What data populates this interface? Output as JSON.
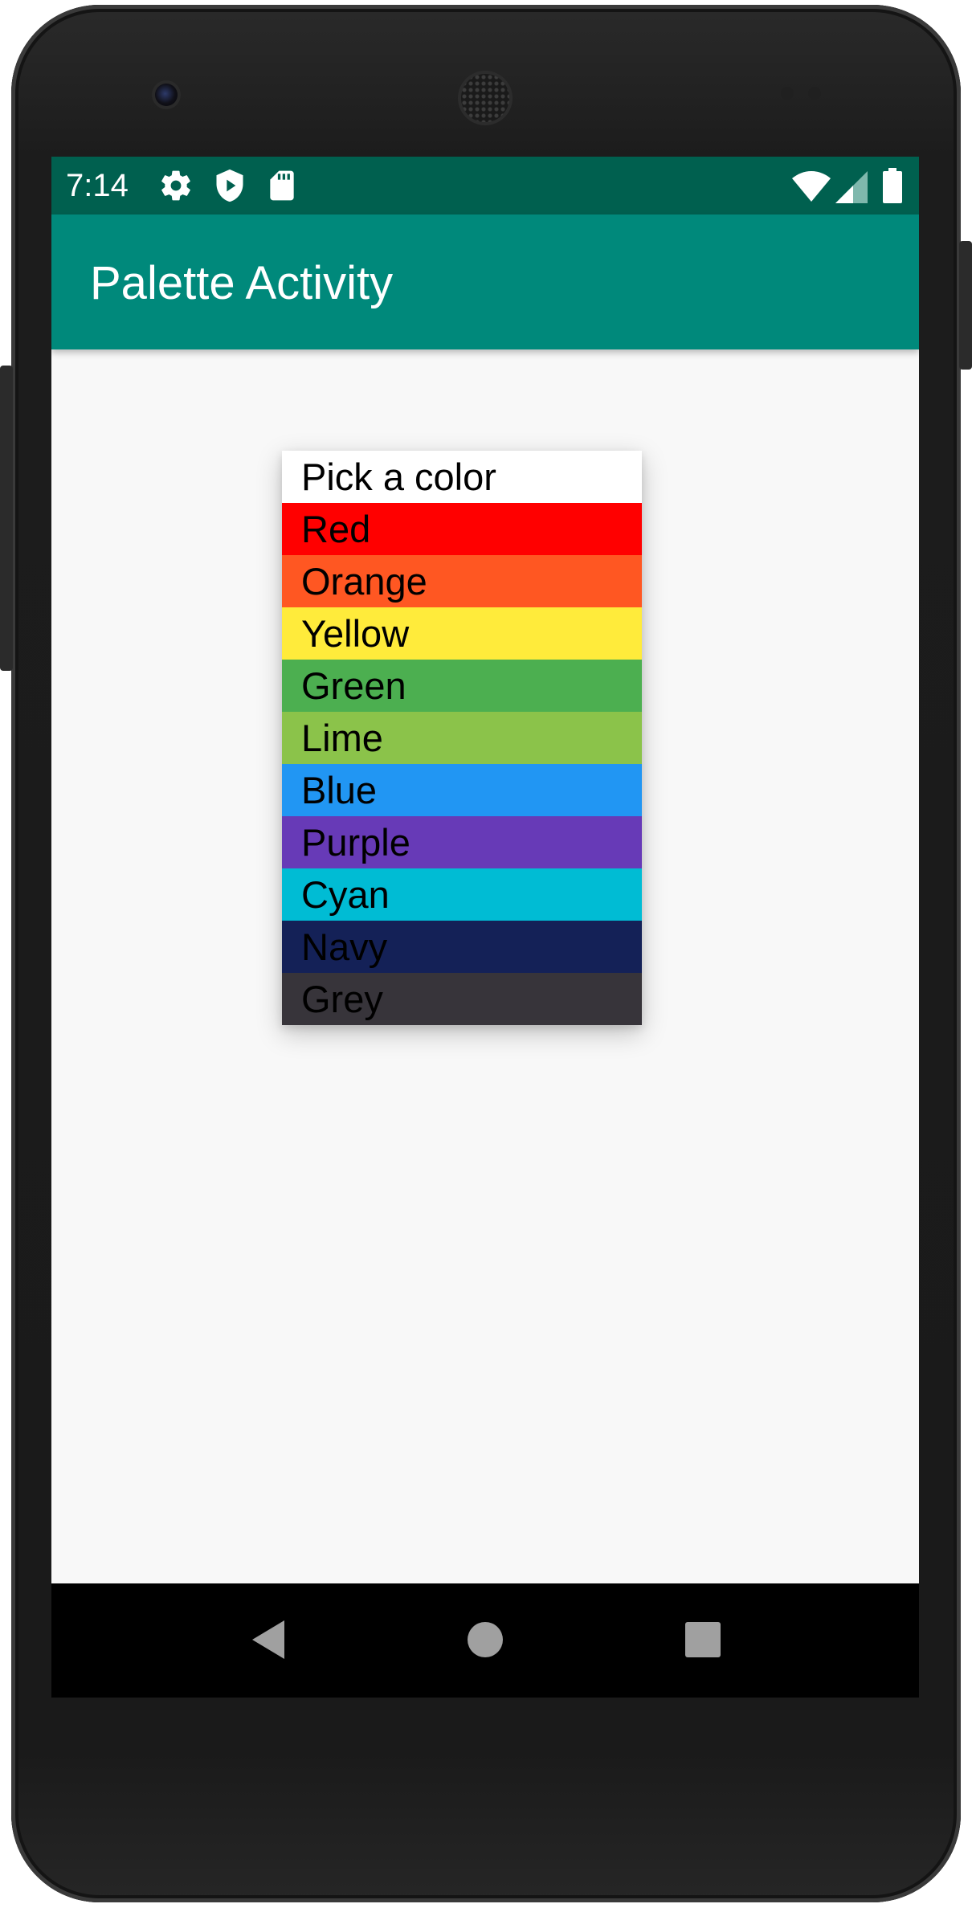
{
  "status_bar": {
    "time": "7:14",
    "left_icons": [
      "settings-gear-icon",
      "play-protect-icon",
      "sd-card-icon"
    ],
    "right_icons": [
      "wifi-icon",
      "cell-signal-icon",
      "battery-icon"
    ]
  },
  "app_bar": {
    "title": "Palette Activity"
  },
  "dropdown": {
    "options": [
      {
        "label": "Pick a color",
        "color": "#ffffff"
      },
      {
        "label": "Red",
        "color": "#ff0000"
      },
      {
        "label": "Orange",
        "color": "#ff5722"
      },
      {
        "label": "Yellow",
        "color": "#ffeb3b"
      },
      {
        "label": "Green",
        "color": "#4caf50"
      },
      {
        "label": "Lime",
        "color": "#8bc34a"
      },
      {
        "label": "Blue",
        "color": "#2196f3"
      },
      {
        "label": "Purple",
        "color": "#673ab7"
      },
      {
        "label": "Cyan",
        "color": "#00bcd4"
      },
      {
        "label": "Navy",
        "color": "#142157"
      },
      {
        "label": "Grey",
        "color": "#37343a"
      }
    ]
  },
  "nav_bar": {
    "buttons": [
      "back-icon",
      "home-icon",
      "recents-icon"
    ]
  },
  "colors": {
    "status_bar": "#00604f",
    "app_bar": "#00897b",
    "background": "#f8f8f8"
  }
}
